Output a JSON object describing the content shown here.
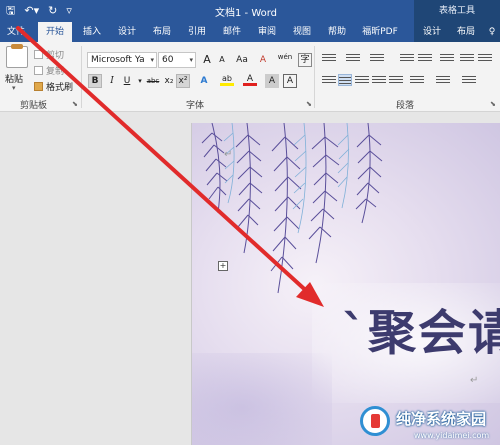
{
  "window": {
    "doc_title": "文档1 - Word",
    "context_tools": "表格工具"
  },
  "quick_access": {
    "save_icon": "save-icon",
    "undo_icon": "undo-icon",
    "redo_icon": "redo-icon",
    "customize_icon": "customize-icon"
  },
  "tabs": [
    "文件",
    "开始",
    "插入",
    "设计",
    "布局",
    "引用",
    "邮件",
    "审阅",
    "视图",
    "帮助",
    "福昕PDF",
    "设计",
    "布局"
  ],
  "active_tab": "开始",
  "clipboard": {
    "paste": "粘贴",
    "cut": "剪切",
    "copy": "复制",
    "format_painter": "格式刷",
    "group_label": "剪贴板"
  },
  "font": {
    "name": "Microsoft Ya",
    "size": "60",
    "grow": "A",
    "shrink": "A",
    "change_case": "Aa",
    "clear": "A",
    "phonetic": "wén",
    "bold": "B",
    "italic": "I",
    "underline": "U",
    "strike": "abc",
    "subscript": "x₂",
    "superscript": "x²",
    "effects": "A",
    "highlight": "ab",
    "font_color": "A",
    "char_shading": "A",
    "enclose": "字",
    "group_label": "字体"
  },
  "paragraph": {
    "group_label": "段落"
  },
  "document": {
    "title_text": "`聚会请",
    "paragraph_mark": "↵"
  },
  "watermark": {
    "title": "纯净系统家园",
    "url": "www.yidaimei.com"
  },
  "colors": {
    "accent": "#2b579a",
    "context": "#1f4676",
    "arrow": "#e12b2b",
    "highlight_bar": "#ffeb00",
    "font_color_bar": "#e0201e"
  }
}
